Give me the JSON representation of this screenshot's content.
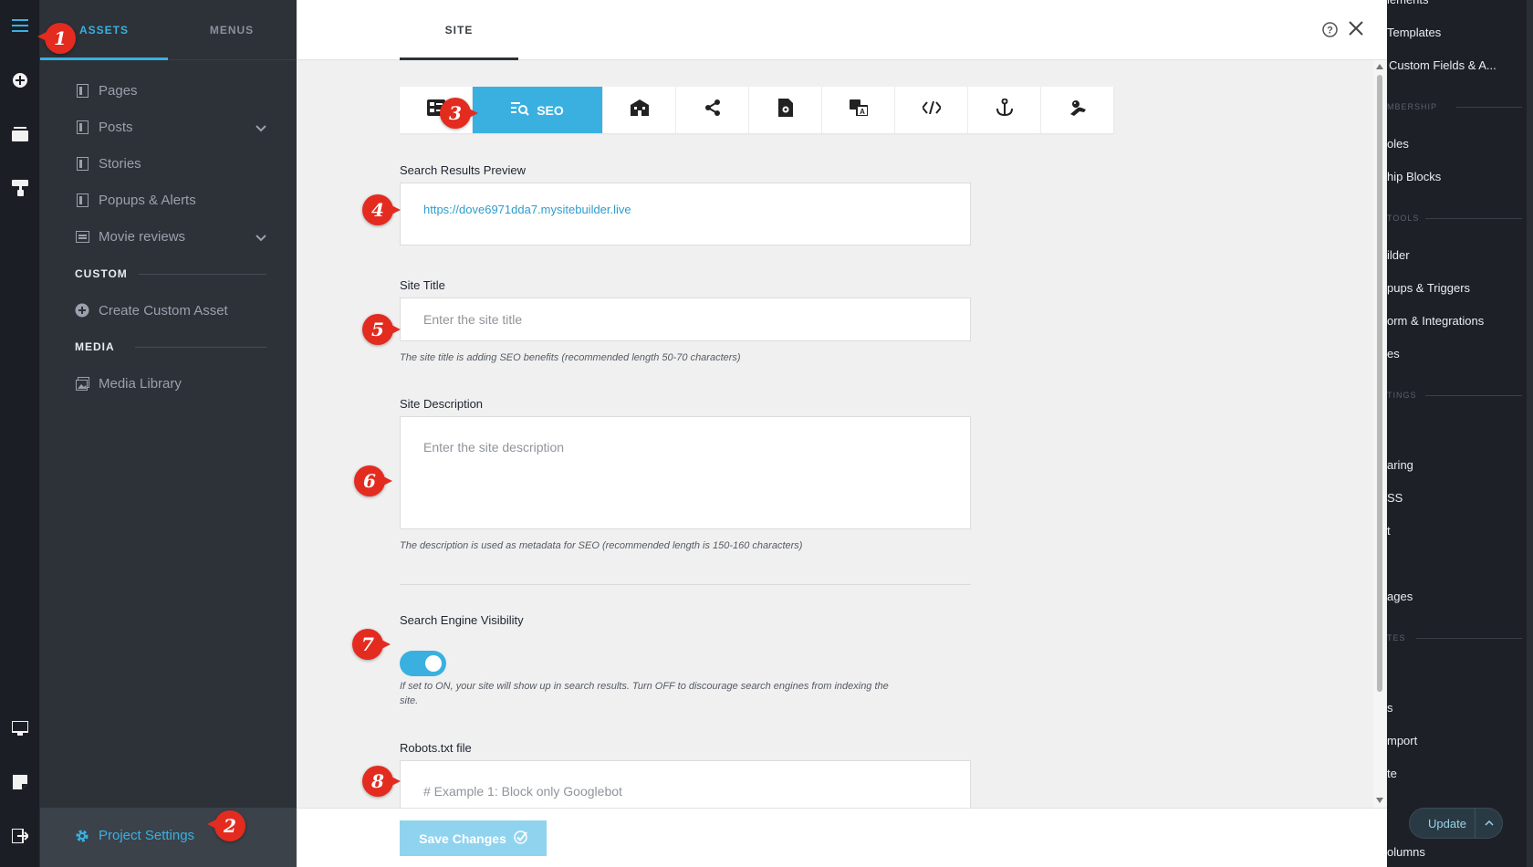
{
  "rail": {
    "icons": [
      "menu-icon",
      "add-circle-icon",
      "layers-icon",
      "paint-roller-icon",
      "desktop-icon",
      "sticky-note-icon",
      "exit-icon"
    ]
  },
  "assets_panel": {
    "tabs": [
      {
        "label": "ASSETS",
        "active": true
      },
      {
        "label": "MENUS",
        "active": false
      }
    ],
    "items": [
      {
        "label": "Pages",
        "icon": "page-icon",
        "expandable": false
      },
      {
        "label": "Posts",
        "icon": "page-icon",
        "expandable": true
      },
      {
        "label": "Stories",
        "icon": "page-icon",
        "expandable": false
      },
      {
        "label": "Popups & Alerts",
        "icon": "page-icon",
        "expandable": false
      },
      {
        "label": "Movie reviews",
        "icon": "list-icon",
        "expandable": true
      }
    ],
    "custom_section": "CUSTOM",
    "create_custom": "Create Custom Asset",
    "media_section": "MEDIA",
    "media_library": "Media Library",
    "project_settings": "Project Settings"
  },
  "modal": {
    "tab_label": "SITE",
    "icon_tabs": [
      {
        "icon": "general-settings-icon"
      },
      {
        "icon": "seo-search-icon",
        "label": "SEO",
        "active": true
      },
      {
        "icon": "building-icon"
      },
      {
        "icon": "share-icon"
      },
      {
        "icon": "page-settings-icon"
      },
      {
        "icon": "translate-icon"
      },
      {
        "icon": "code-icon"
      },
      {
        "icon": "anchor-icon"
      },
      {
        "icon": "cookie-hand-icon"
      }
    ],
    "preview_label": "Search Results Preview",
    "preview_url": "https://dove6971dda7.mysitebuilder.live",
    "site_title_label": "Site Title",
    "site_title_placeholder": "Enter the site title",
    "site_title_hint": "The site title is adding SEO benefits (recommended length 50-70 characters)",
    "site_desc_label": "Site Description",
    "site_desc_placeholder": "Enter the site description",
    "site_desc_hint": "The description is used as metadata for SEO (recommended length is 150-160 characters)",
    "visibility_label": "Search Engine Visibility",
    "visibility_on": true,
    "visibility_hint_1": "If set to ON, your site will show up in search results. Turn OFF to discourage search engines from indexing the",
    "visibility_hint_2": "site.",
    "robots_label": "Robots.txt file",
    "robots_placeholder": "# Example 1: Block only Googlebot",
    "save_button": "Save Changes"
  },
  "right_panel": {
    "items": [
      "lements",
      "Templates",
      "Custom Fields & A...",
      "oles",
      "hip Blocks",
      "ilder",
      "pups & Triggers",
      "orm & Integrations",
      "es",
      "aring",
      "SS",
      "t",
      "ages",
      "s",
      "mport",
      "te",
      "olumns"
    ],
    "sections": [
      "MBERSHIP",
      "TOOLS",
      "TINGS",
      "TES"
    ],
    "update_button": "Update"
  },
  "markers": [
    "1",
    "2",
    "3",
    "4",
    "5",
    "6",
    "7",
    "8"
  ],
  "colors": {
    "accent": "#3ab0e0",
    "marker": "#e32b1f",
    "sidebar": "#2d3138",
    "rail": "#1b1e24"
  }
}
